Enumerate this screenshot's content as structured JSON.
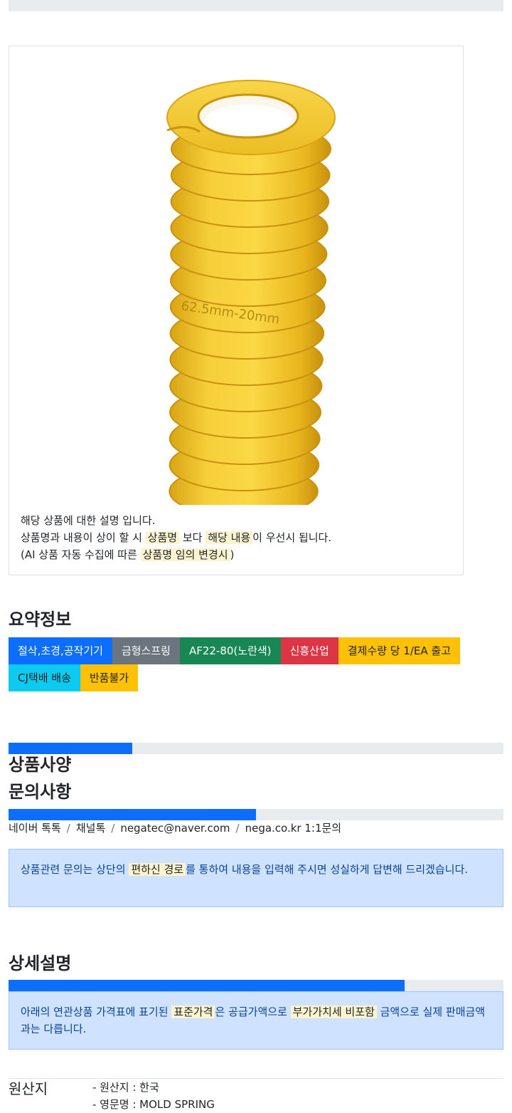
{
  "product": {
    "image_alt": "yellow-die-spring",
    "spring_marking": "62.5mm-20mm",
    "desc_line1": "해당 상품에 대한 설명 입니다.",
    "desc_line2_a": "상품명과 내용이 상이 할 시 ",
    "desc_line2_mark1": "상품명",
    "desc_line2_b": " 보다 ",
    "desc_line2_mark2": "해당 내용",
    "desc_line2_c": "이 우선시 됩니다.",
    "desc_line3_a": "(AI 상품 자동 수집에 따른 ",
    "desc_line3_mark": "상품명 임의 변경시",
    "desc_line3_b": ")"
  },
  "summary": {
    "title": "요약정보",
    "badges_row1": [
      {
        "label": "절삭,초경,공작기기",
        "color": "#0d6efd"
      },
      {
        "label": "금형스프링",
        "color": "#6c757d"
      },
      {
        "label": "AF22-80(노란색)",
        "color": "#198754"
      },
      {
        "label": "신흥산업",
        "color": "#dc3545"
      },
      {
        "label": "결제수량 당 1/EA 출고",
        "color": "#ffc107"
      }
    ],
    "badges_row2": [
      {
        "label": "CJ택배 배송",
        "color": "#0dcaf0"
      },
      {
        "label": "반품불가",
        "color": "#ffc107"
      }
    ]
  },
  "spec": {
    "title": "상품사양",
    "progress": 0.25
  },
  "inquiry": {
    "title": "문의사항",
    "progress": 0.5,
    "contacts": [
      "네이버 톡톡",
      "채널톡",
      "negatec@naver.com",
      "nega.co.kr 1:1문의"
    ],
    "separator": "/",
    "alert_a": "상품관련 문의는 상단의 ",
    "alert_mark": "편하신 경로",
    "alert_b": "를 통하여 내용을 입력해 주시면 성실하게 답변해 드리겠습니다."
  },
  "detail": {
    "title": "상세설명",
    "progress": 0.8,
    "alert_a": "아래의 연관상품 가격표에 표기된 ",
    "alert_mark1": "표준가격",
    "alert_b": "은 공급가액으로 ",
    "alert_mark2": "부가가치세 비포함",
    "alert_c": " 금액으로 실제 판매금액과는 다릅니다."
  },
  "origin": {
    "label": "원산지",
    "items": [
      "- 원산지 : 한국",
      "- 영문명 : MOLD SPRING"
    ]
  },
  "colors": {
    "primary": "#0d6efd",
    "spring_yellow": "#f2c21b",
    "alert_bg": "#cfe2ff",
    "mark_bg": "#fcf3cf"
  }
}
